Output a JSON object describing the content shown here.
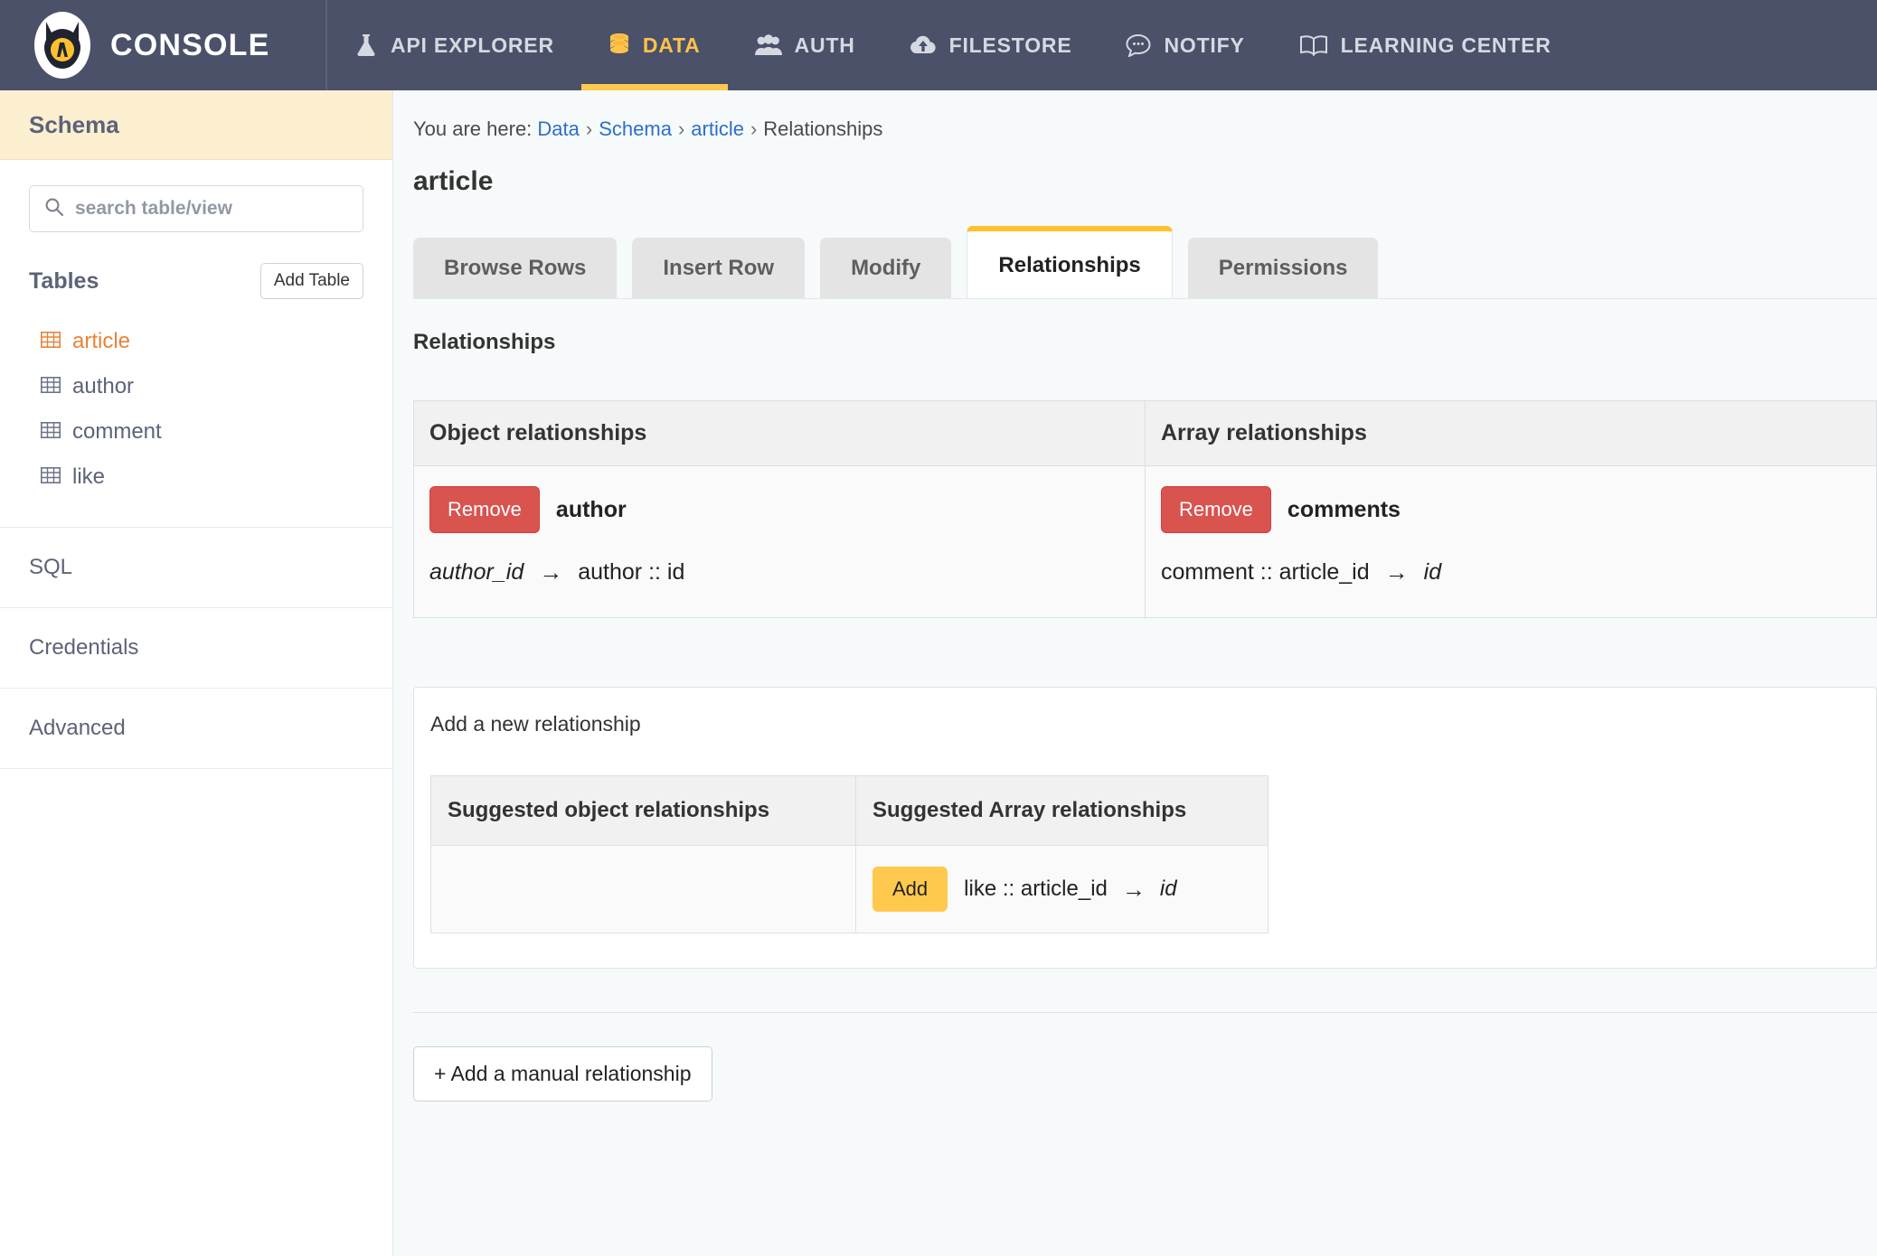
{
  "topnav": {
    "brand": "CONSOLE",
    "logo_icon": "hasura-logo-icon",
    "items": [
      {
        "label": "API EXPLORER",
        "icon": "flask-icon",
        "active": false
      },
      {
        "label": "DATA",
        "icon": "database-icon",
        "active": true
      },
      {
        "label": "AUTH",
        "icon": "users-icon",
        "active": false
      },
      {
        "label": "FILESTORE",
        "icon": "cloud-upload-icon",
        "active": false
      },
      {
        "label": "NOTIFY",
        "icon": "chat-bubble-icon",
        "active": false
      },
      {
        "label": "LEARNING CENTER",
        "icon": "open-book-icon",
        "active": false
      }
    ],
    "active_color": "#ffc24b",
    "bar_color": "#4a5169"
  },
  "sidebar": {
    "heading": "Schema",
    "search": {
      "placeholder": "search table/view",
      "value": "",
      "icon": "search-icon"
    },
    "tables_label": "Tables",
    "add_table_label": "Add Table",
    "tables": [
      {
        "name": "article",
        "icon": "table-grid-icon",
        "active": true
      },
      {
        "name": "author",
        "icon": "table-grid-icon",
        "active": false
      },
      {
        "name": "comment",
        "icon": "table-grid-icon",
        "active": false
      },
      {
        "name": "like",
        "icon": "table-grid-icon",
        "active": false
      }
    ],
    "links": [
      {
        "label": "SQL"
      },
      {
        "label": "Credentials"
      },
      {
        "label": "Advanced"
      }
    ],
    "active_table_color": "#e8833a"
  },
  "breadcrumb": {
    "prefix": "You are here:",
    "items": [
      {
        "label": "Data",
        "link": true
      },
      {
        "label": "Schema",
        "link": true
      },
      {
        "label": "article",
        "link": true
      },
      {
        "label": "Relationships",
        "link": false
      }
    ],
    "separator": "›"
  },
  "page": {
    "title": "article",
    "tabs": [
      {
        "label": "Browse Rows",
        "active": false
      },
      {
        "label": "Insert Row",
        "active": false
      },
      {
        "label": "Modify",
        "active": false
      },
      {
        "label": "Relationships",
        "active": true
      },
      {
        "label": "Permissions",
        "active": false
      }
    ],
    "section_title": "Relationships"
  },
  "relationships": {
    "columns": [
      {
        "header": "Object relationships",
        "rows": [
          {
            "button": "Remove",
            "name": "author",
            "source": "author_id",
            "source_italic": true,
            "arrow": "→",
            "target": "author :: id",
            "target_italic": false
          }
        ]
      },
      {
        "header": "Array relationships",
        "rows": [
          {
            "button": "Remove",
            "name": "comments",
            "source": "comment :: article_id",
            "source_italic": false,
            "arrow": "→",
            "target": "id",
            "target_italic": true
          }
        ]
      }
    ]
  },
  "add_new": {
    "title": "Add a new relationship",
    "headers": [
      "Suggested object relationships",
      "Suggested Array relationships"
    ],
    "object_suggestions": [],
    "array_suggestions": [
      {
        "button": "Add",
        "source": "like :: article_id",
        "arrow": "→",
        "target": "id",
        "target_italic": true
      }
    ]
  },
  "footer": {
    "manual_relationship_label": "+ Add a manual relationship"
  }
}
